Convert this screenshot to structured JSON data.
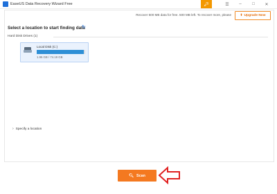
{
  "window": {
    "title": "EaseUS Data Recovery Wizard Free",
    "controls": [
      "key-icon",
      "menu-icon",
      "minimize-icon",
      "maximize-icon",
      "close-icon"
    ]
  },
  "header": {
    "notice": "Recover 500 MB data for free. 500 MB left. To recover more, please",
    "upgrade_label": "Upgrade Now"
  },
  "location": {
    "title": "Select a location to start finding data",
    "group_label": "Hard Disk Drives (1)",
    "drives": [
      {
        "name": "Local Disk (C:)",
        "size": "1.95 GB / 74.19 GB",
        "used_fraction": 0.97
      }
    ],
    "specify_label": "Specify a location"
  },
  "actions": {
    "scan_label": "Scan"
  },
  "colors": {
    "accent": "#f47920",
    "arrow": "#e02020",
    "drive_bar": "#2e8fd6",
    "key_button": "#f39800"
  }
}
